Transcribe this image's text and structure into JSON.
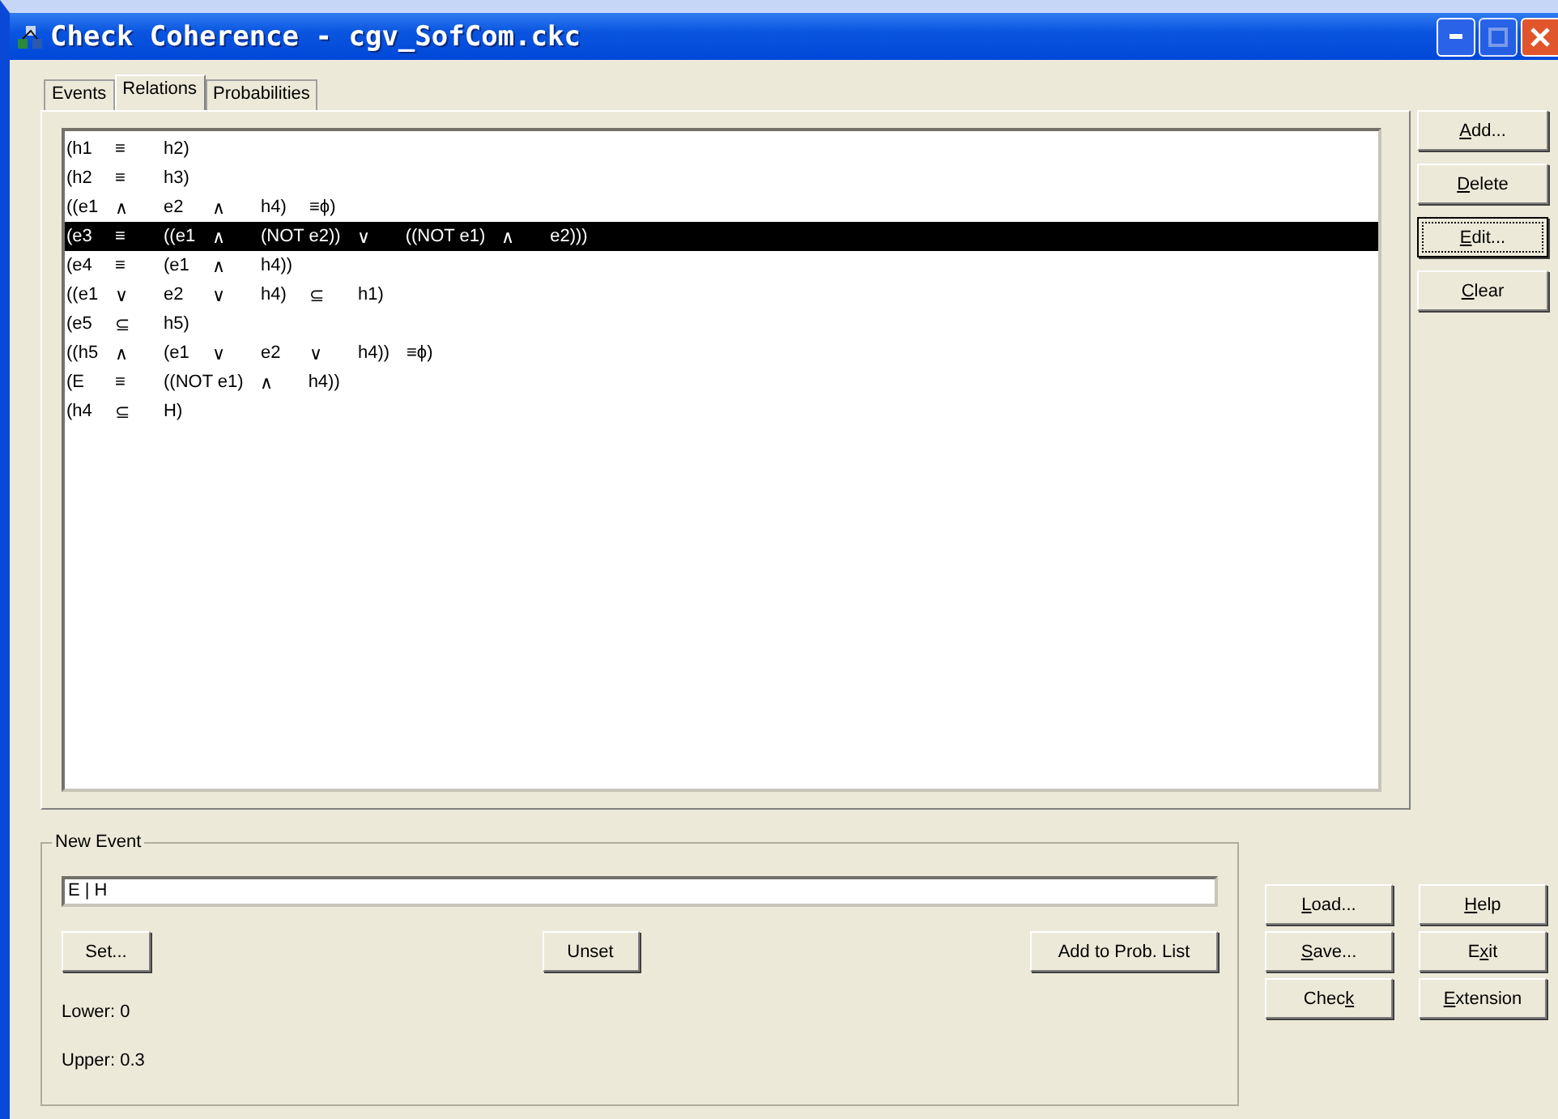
{
  "window": {
    "title": "Check Coherence  -  cgv_SofCom.ckc"
  },
  "tabs": [
    {
      "label": "Events",
      "selected": false
    },
    {
      "label": "Relations",
      "selected": true
    },
    {
      "label": "Probabilities",
      "selected": false
    }
  ],
  "relations": [
    {
      "tokens": [
        "(h1",
        "≡",
        "h2)"
      ],
      "selected": false
    },
    {
      "tokens": [
        "(h2",
        "≡",
        "h3)"
      ],
      "selected": false
    },
    {
      "tokens": [
        "((e1",
        "∧",
        "e2",
        "∧",
        "h4)",
        "≡ϕ)"
      ],
      "selected": false
    },
    {
      "tokens": [
        "(e3",
        "≡",
        "((e1",
        "∧",
        "(NOT e2))",
        "∨",
        "((NOT e1)",
        "∧",
        "e2)))"
      ],
      "selected": true
    },
    {
      "tokens": [
        "(e4",
        "≡",
        "(e1",
        "∧",
        "h4))"
      ],
      "selected": false
    },
    {
      "tokens": [
        "((e1",
        "∨",
        "e2",
        "∨",
        "h4)",
        "⊆",
        "h1)"
      ],
      "selected": false
    },
    {
      "tokens": [
        "(e5",
        "⊆",
        "h5)"
      ],
      "selected": false
    },
    {
      "tokens": [
        "((h5",
        "∧",
        "(e1",
        "∨",
        "e2",
        "∨",
        "h4))",
        "≡ϕ)"
      ],
      "selected": false
    },
    {
      "tokens": [
        "(E",
        "≡",
        "((NOT e1)",
        "∧",
        "h4))"
      ],
      "selected": false
    },
    {
      "tokens": [
        "(h4",
        "⊆",
        "H)"
      ],
      "selected": false
    }
  ],
  "side_buttons": [
    {
      "key": "A",
      "post": "dd...",
      "focused": false
    },
    {
      "key": "D",
      "post": "elete",
      "focused": false
    },
    {
      "key": "E",
      "post": "dit...",
      "focused": true
    },
    {
      "key": "C",
      "post": "lear",
      "focused": false
    }
  ],
  "new_event": {
    "legend": "New Event",
    "value": "E | H",
    "set_button": "Set...",
    "unset_button": "Unset",
    "add_button": "Add to Prob. List",
    "lower": "Lower: 0",
    "upper": "Upper: 0.3"
  },
  "file_buttons": [
    {
      "key": "L",
      "post": "oad..."
    },
    {
      "key": "S",
      "post": "ave..."
    },
    {
      "pre": "Chec",
      "key": "k"
    }
  ],
  "app_buttons": [
    {
      "key": "H",
      "post": "elp"
    },
    {
      "pre": "E",
      "key": "x",
      "post": "it"
    },
    {
      "key": "E",
      "post": "xtension"
    }
  ]
}
